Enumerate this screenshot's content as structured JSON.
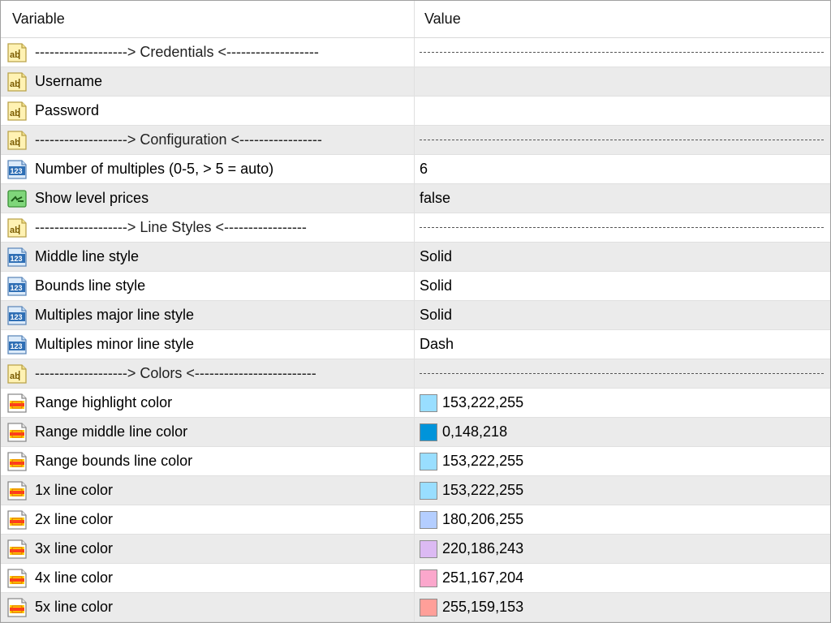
{
  "columns": {
    "variable": "Variable",
    "value": "Value"
  },
  "rows": [
    {
      "type": "separator",
      "icon": "string-icon",
      "name": "------------------->  Credentials  <-------------------",
      "value": ""
    },
    {
      "type": "string",
      "icon": "string-icon",
      "name": "Username",
      "value": ""
    },
    {
      "type": "string",
      "icon": "string-icon",
      "name": "Password",
      "value": ""
    },
    {
      "type": "separator",
      "icon": "string-icon",
      "name": "------------------->  Configuration  <-----------------",
      "value": ""
    },
    {
      "type": "int",
      "icon": "number-icon",
      "name": "Number of multiples (0-5, > 5 = auto)",
      "value": "6"
    },
    {
      "type": "bool",
      "icon": "bool-icon",
      "name": "Show level prices",
      "value": "false"
    },
    {
      "type": "separator",
      "icon": "string-icon",
      "name": "------------------->  Line Styles  <-----------------",
      "value": ""
    },
    {
      "type": "enum",
      "icon": "number-icon",
      "name": "Middle line style",
      "value": "Solid"
    },
    {
      "type": "enum",
      "icon": "number-icon",
      "name": "Bounds line style",
      "value": "Solid"
    },
    {
      "type": "enum",
      "icon": "number-icon",
      "name": "Multiples major line style",
      "value": "Solid"
    },
    {
      "type": "enum",
      "icon": "number-icon",
      "name": "Multiples minor line style",
      "value": "Dash"
    },
    {
      "type": "separator",
      "icon": "string-icon",
      "name": "------------------->  Colors  <-------------------------",
      "value": ""
    },
    {
      "type": "color",
      "icon": "color-icon",
      "name": "Range highlight color",
      "value": "153,222,255",
      "color": "#99DEFF"
    },
    {
      "type": "color",
      "icon": "color-icon",
      "name": "Range middle line color",
      "value": "0,148,218",
      "color": "#0094DA"
    },
    {
      "type": "color",
      "icon": "color-icon",
      "name": "Range bounds line color",
      "value": "153,222,255",
      "color": "#99DEFF"
    },
    {
      "type": "color",
      "icon": "color-icon",
      "name": "1x line color",
      "value": "153,222,255",
      "color": "#99DEFF"
    },
    {
      "type": "color",
      "icon": "color-icon",
      "name": "2x line color",
      "value": "180,206,255",
      "color": "#B4CEFF"
    },
    {
      "type": "color",
      "icon": "color-icon",
      "name": "3x line color",
      "value": "220,186,243",
      "color": "#DCBAF3"
    },
    {
      "type": "color",
      "icon": "color-icon",
      "name": "4x line color",
      "value": "251,167,204",
      "color": "#FBA7CC"
    },
    {
      "type": "color",
      "icon": "color-icon",
      "name": "5x line color",
      "value": "255,159,153",
      "color": "#FF9F99"
    }
  ]
}
